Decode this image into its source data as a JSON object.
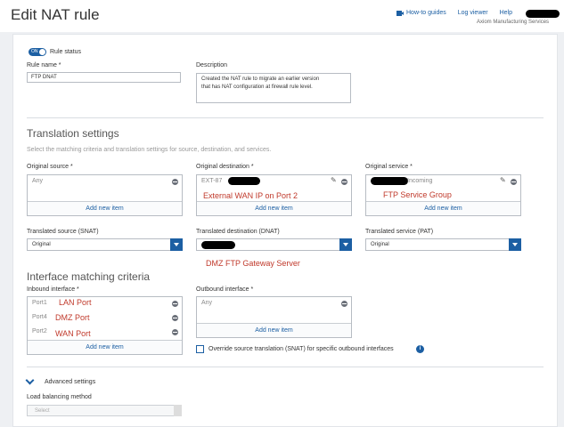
{
  "header": {
    "title": "Edit NAT rule",
    "links": {
      "howto": "How-to guides",
      "log": "Log viewer",
      "help": "Help"
    },
    "company": "Axiom Manufacturing Services"
  },
  "rule": {
    "status_toggle": "ON",
    "status_label": "Rule status",
    "name_label": "Rule name *",
    "name_value": "FTP DNAT",
    "desc_label": "Description",
    "desc_lines": [
      "Created the NAT rule to migrate an earlier version",
      "that has NAT configuration at firewall rule level."
    ]
  },
  "translation": {
    "title": "Translation settings",
    "subtitle": "Select the matching criteria and translation settings for source, destination, and services.",
    "original_source": {
      "label": "Original source *",
      "item": "Any",
      "add": "Add new item"
    },
    "original_destination": {
      "label": "Original destination *",
      "item": "EXT-87",
      "add": "Add new item",
      "annotation": "External WAN IP on Port 2"
    },
    "original_service": {
      "label": "Original service *",
      "item": "Incoming",
      "add": "Add new item",
      "annotation": "FTP Service Group"
    },
    "snat": {
      "label": "Translated source (SNAT)",
      "value": "Original"
    },
    "dnat": {
      "label": "Translated destination (DNAT)",
      "value": "",
      "annotation": "DMZ FTP Gateway Server"
    },
    "pat": {
      "label": "Translated service (PAT)",
      "value": "Original"
    }
  },
  "interface": {
    "title": "Interface matching criteria",
    "inbound": {
      "label": "Inbound interface *",
      "items": [
        {
          "name": "Port1",
          "note": "LAN Port"
        },
        {
          "name": "Port4",
          "note": "DMZ Port"
        },
        {
          "name": "Port2",
          "note": "WAN Port"
        }
      ],
      "add": "Add new item"
    },
    "outbound": {
      "label": "Outbound interface *",
      "item": "Any",
      "add": "Add new item"
    },
    "override": "Override source translation (SNAT) for specific outbound interfaces"
  },
  "advanced": {
    "title": "Advanced settings",
    "lb_label": "Load balancing method",
    "lb_value": "Select"
  }
}
